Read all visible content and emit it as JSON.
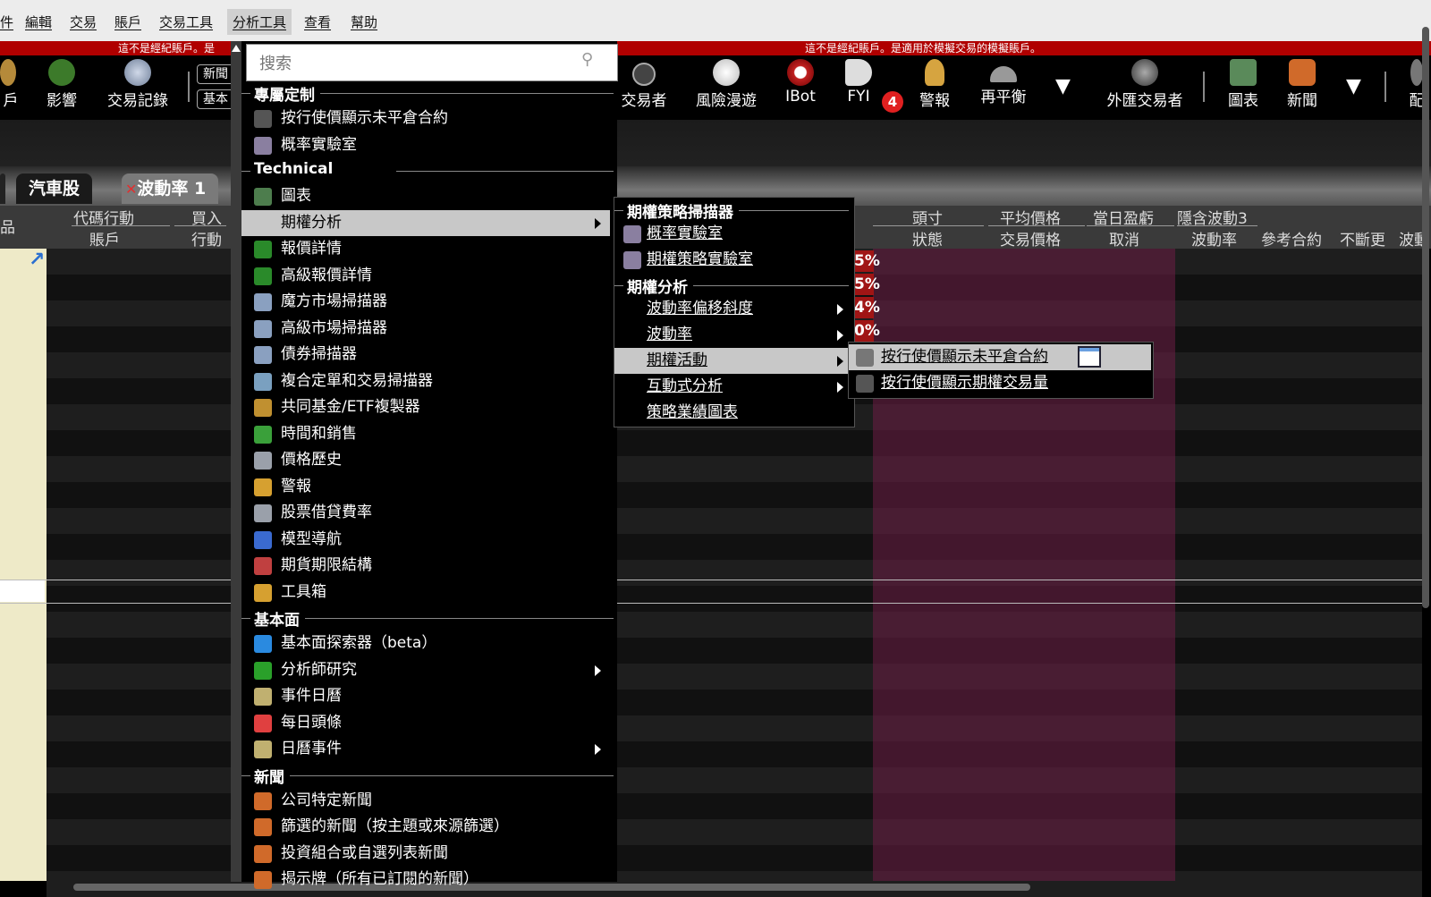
{
  "menubar": {
    "items": [
      "件",
      "編輯",
      "交易",
      "賬戶",
      "交易工具",
      "分析工具",
      "查看",
      "幫助"
    ],
    "active_index": 5
  },
  "banner": {
    "left_text": "這不是經紀賬戶。是",
    "center_text": "這不是經紀賬戶。是適用於模擬交易的模擬賬戶。"
  },
  "toolbar": {
    "left": [
      {
        "label": "戶",
        "icon": "coins-icon"
      },
      {
        "label": "影響",
        "icon": "plant-icon"
      },
      {
        "label": "交易記錄",
        "icon": "globe-icon"
      }
    ],
    "small_buttons": [
      "新聞",
      "基本"
    ],
    "right": [
      {
        "label": "交易者",
        "icon": "chain-icon"
      },
      {
        "label": "風險漫遊",
        "icon": "compass-icon"
      },
      {
        "label": "IBot",
        "icon": "bot-icon"
      },
      {
        "label": "FYI",
        "icon": "megaphone-icon"
      },
      {
        "label": "警報",
        "icon": "bell-icon"
      },
      {
        "label": "再平衡",
        "icon": "gauge-icon"
      },
      {
        "label": "外匯交易者",
        "icon": "fx-icon"
      },
      {
        "label": "圖表",
        "icon": "chart-icon"
      },
      {
        "label": "新聞",
        "icon": "rss-icon"
      },
      {
        "label": "配",
        "icon": "tool-icon"
      }
    ],
    "fyi_badge": "4",
    "dropdown_glyph": "▼"
  },
  "tabs": [
    {
      "label": "汽車股"
    },
    {
      "label": "波動率 1",
      "close": "✕"
    }
  ],
  "grid": {
    "header_top": [
      "代碼行動",
      "買入",
      "頭寸",
      "平均價格",
      "當日盈虧",
      "隱含波動3"
    ],
    "header_bottom": [
      "品",
      "賬戶",
      "行動",
      "狀態",
      "交易價格",
      "取消",
      "波動率",
      "參考合約",
      "不斷更",
      "波動"
    ],
    "pct_cells": [
      "5%",
      "5%",
      "4%",
      "0%"
    ],
    "link_glyph": "↗"
  },
  "search": {
    "placeholder": "搜索"
  },
  "main_menu": {
    "sections": [
      {
        "title": "專屬定制",
        "items": [
          {
            "label": "按行使價顯示未平倉合約",
            "icon": "sparkline-icon"
          },
          {
            "label": "概率實驗室",
            "icon": "lab-icon"
          }
        ]
      },
      {
        "title": "Technical",
        "items": [
          {
            "label": "圖表",
            "icon": "chart-icon"
          },
          {
            "label": "期權分析",
            "icon": "",
            "submenu": true,
            "highlighted": true
          },
          {
            "label": "報價詳情",
            "icon": "updown-arrows-icon"
          },
          {
            "label": "高級報價詳情",
            "icon": "updown-arrows-icon"
          },
          {
            "label": "魔方市場掃描器",
            "icon": "magnifier-icon"
          },
          {
            "label": "高級市場掃描器",
            "icon": "magnifier-icon"
          },
          {
            "label": "債券掃描器",
            "icon": "magnifier-icon"
          },
          {
            "label": "複合定單和交易掃描器",
            "icon": "scanner-icon"
          },
          {
            "label": "共同基金/ETF複製器",
            "icon": "scales-icon"
          },
          {
            "label": "時間和銷售",
            "icon": "clock-icon"
          },
          {
            "label": "價格歷史",
            "icon": "history-icon"
          },
          {
            "label": "警報",
            "icon": "alert-icon"
          },
          {
            "label": "股票借貸費率",
            "icon": "rate-icon"
          },
          {
            "label": "模型導航",
            "icon": "model-icon"
          },
          {
            "label": "期貨期限結構",
            "icon": "futures-icon"
          },
          {
            "label": "工具箱",
            "icon": "toolbox-icon"
          }
        ]
      },
      {
        "title": "基本面",
        "items": [
          {
            "label": "基本面探索器（beta）",
            "icon": "building-icon"
          },
          {
            "label": "分析師研究",
            "icon": "puzzle-icon",
            "submenu": true
          },
          {
            "label": "事件日曆",
            "icon": "calendar-icon"
          },
          {
            "label": "每日頭條",
            "icon": "headline-icon"
          },
          {
            "label": "日曆事件",
            "icon": "calendar-icon",
            "submenu": true
          }
        ]
      },
      {
        "title": "新聞",
        "items": [
          {
            "label": "公司特定新聞",
            "icon": "rss-icon"
          },
          {
            "label": "篩選的新聞（按主題或來源篩選）",
            "icon": "rss-icon"
          },
          {
            "label": "投資組合或自選列表新聞",
            "icon": "rss-icon"
          },
          {
            "label": "揭示牌（所有已訂閱的新聞）",
            "icon": "rss-icon"
          }
        ]
      }
    ]
  },
  "options_menu": {
    "sections": [
      {
        "title": "期權策略掃描器",
        "items": [
          {
            "label": "概率實驗室",
            "icon": "lab-icon"
          },
          {
            "label": "期權策略實驗室",
            "icon": "lab-icon"
          }
        ]
      },
      {
        "title": "期權分析",
        "items": [
          {
            "label": "波動率偏移斜度",
            "submenu": true
          },
          {
            "label": "波動率",
            "submenu": true
          },
          {
            "label": "期權活動",
            "submenu": true,
            "highlighted": true
          },
          {
            "label": "互動式分析",
            "submenu": true
          },
          {
            "label": "策略業績圖表"
          }
        ]
      }
    ]
  },
  "activity_menu": {
    "items": [
      {
        "label": "按行使價顯示未平倉合約",
        "icon": "bug-icon",
        "highlighted": true
      },
      {
        "label": "按行使價顯示期權交易量",
        "icon": "sparkline-icon"
      }
    ]
  },
  "colors": {
    "menubar_bg": "#ececec",
    "banner_red": "#b00000",
    "highlight": "#c8c8c8",
    "pink_column": "#5a1a3a",
    "badge_red": "#e02020"
  }
}
